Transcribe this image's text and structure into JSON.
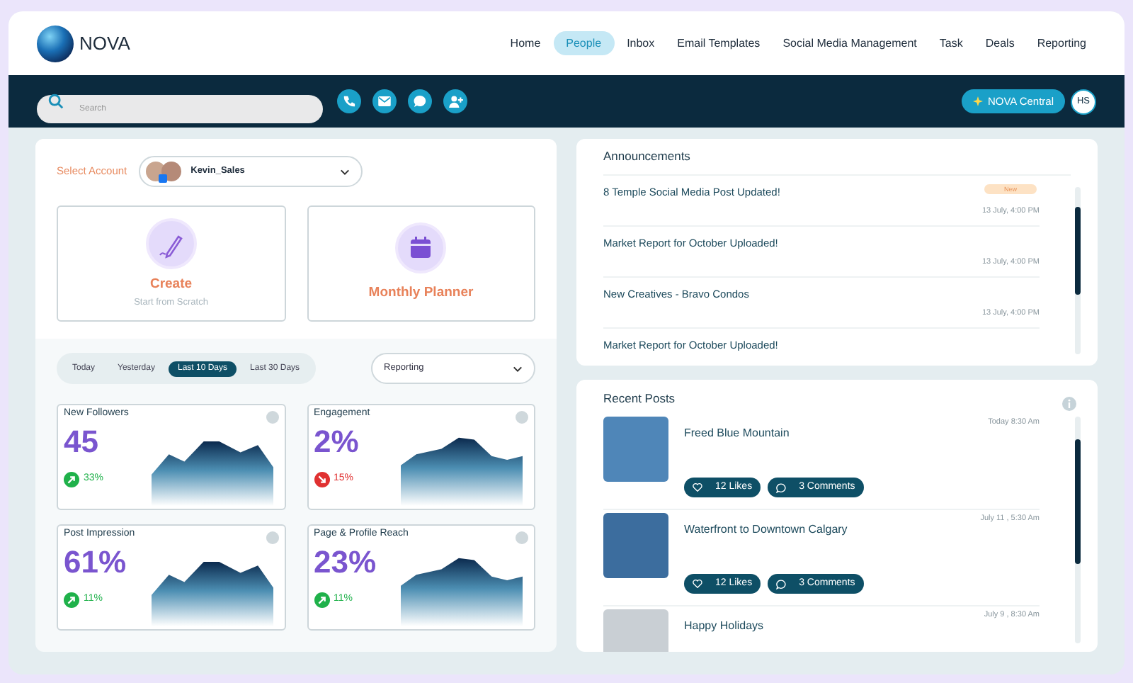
{
  "brand": {
    "name": "NOVA"
  },
  "nav": [
    {
      "label": "Home",
      "selected": false
    },
    {
      "label": "People",
      "selected": true
    },
    {
      "label": "Inbox",
      "selected": false
    },
    {
      "label": "Email Templates",
      "selected": false
    },
    {
      "label": "Social Media Management",
      "selected": false
    },
    {
      "label": "Task",
      "selected": false
    },
    {
      "label": "Deals",
      "selected": false
    },
    {
      "label": "Reporting",
      "selected": false
    }
  ],
  "toolbar": {
    "search": {
      "placeholder": "Search"
    },
    "central_button": "NOVA Central",
    "avatar": "HS"
  },
  "account": {
    "label": "Select Account",
    "value": "Kevin_Sales"
  },
  "actions": [
    {
      "kind": "create",
      "title": "Create",
      "subtitle": "Start from Scratch"
    },
    {
      "kind": "planner",
      "title": "Monthly Planner"
    }
  ],
  "ranges": [
    {
      "label": "Today",
      "selected": false
    },
    {
      "label": "Yesterday",
      "selected": false
    },
    {
      "label": "Last 10 Days",
      "selected": true
    },
    {
      "label": "Last 30 Days",
      "selected": false
    }
  ],
  "report_select": {
    "value": "Reporting"
  },
  "stats": [
    {
      "title": "New Followers",
      "value": "45",
      "kind": "up",
      "change": "33%"
    },
    {
      "title": "Engagement",
      "value": "2%",
      "kind": "down",
      "change": "15%"
    },
    {
      "title": "Post Impression",
      "value": "61%",
      "kind": "up",
      "change": "11%"
    },
    {
      "title": "Page & Profile Reach",
      "value": "23%",
      "kind": "up",
      "change": "11%"
    }
  ],
  "announcements": {
    "title": "Announcements",
    "items": [
      {
        "text": "8 Temple Social Media Post Updated!",
        "badge": "New",
        "date": "13 July, 4:00 PM"
      },
      {
        "text": "Market Report for October Uploaded!",
        "date": "13 July, 4:00 PM"
      },
      {
        "text": "New Creatives - Bravo Condos",
        "date": "13 July, 4:00 PM"
      },
      {
        "text": "Market Report for October Uploaded!"
      }
    ]
  },
  "recent_posts": {
    "title": "Recent Posts",
    "items": [
      {
        "title": "Freed Blue Mountain",
        "date": "Today 8:30 Am",
        "likes": "12 Likes",
        "comments": "3 Comments"
      },
      {
        "title": "Waterfront to Downtown Calgary",
        "date": "July 11 , 5:30 Am",
        "likes": "12 Likes",
        "comments": "3 Comments"
      },
      {
        "title": "Happy Holidays",
        "date": "July 9 , 8:30 Am"
      }
    ]
  }
}
